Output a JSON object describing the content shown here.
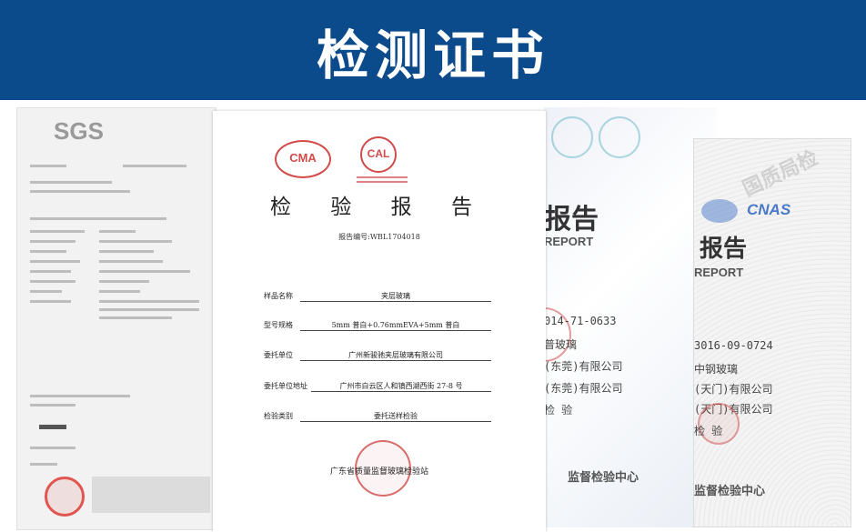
{
  "header": {
    "title": "检测证书",
    "background_color": "#0b4a8b"
  },
  "left_document": {
    "logo_text": "SGS"
  },
  "center_document": {
    "logos": [
      "CMA",
      "CAL"
    ],
    "title": "检 验 报 告",
    "report_number": "报告编号:WBL1704018",
    "fields": [
      {
        "label": "样品名称",
        "value": "夹层玻璃"
      },
      {
        "label": "型号规格",
        "value": "5mm 普白+0.76mmEVA+5mm 普白"
      },
      {
        "label": "委托单位",
        "value": "广州新骏驰夹层玻璃有限公司"
      },
      {
        "label": "委托单位地址",
        "value": "广州市白云区人和镇西湖西街 27-8 号"
      },
      {
        "label": "检验类别",
        "value": "委托送样检验"
      }
    ],
    "issuer": "广东省质量监督玻璃检验站",
    "stamp_color": "#d24a4a"
  },
  "right_document_1": {
    "heading": "报告",
    "subheading": "REPORT",
    "lines": [
      "014-71-0633",
      "普玻璃",
      "(东莞)有限公司",
      "(东莞)有限公司",
      "检 验"
    ],
    "footer": "监督检验中心"
  },
  "right_document_2": {
    "logo_text": "CNAS",
    "heading": "报告",
    "subheading": "REPORT",
    "watermark": "国质局检",
    "lines": [
      "3016-09-0724",
      "中钢玻璃",
      "(天门)有限公司",
      "(天门)有限公司",
      "检 验"
    ],
    "footer": "监督检验中心"
  }
}
